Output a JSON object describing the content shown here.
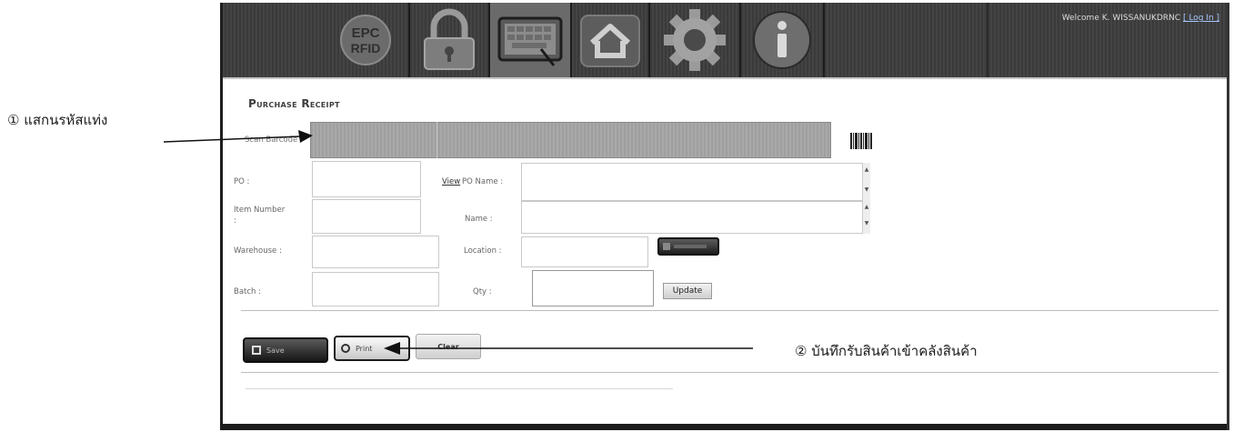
{
  "header": {
    "logo_text": "EPC RFID",
    "welcome_text": "Welcome K. WISSANUKDRNC",
    "login_label": "[ Log In ]"
  },
  "form": {
    "title": "Purchase Receipt",
    "scan_barcode_label": "Scan Barcode",
    "po_label": "PO :",
    "view_link": "View",
    "po_name_label": "PO Name :",
    "item_number_label": "Item Number :",
    "name_label": "Name :",
    "warehouse_label": "Warehouse :",
    "location_label": "Location :",
    "batch_label": "Batch :",
    "qty_label": "Qty :",
    "update_button": "Update",
    "save_button": "Save",
    "print_button": "Print",
    "clear_button": "Clear"
  },
  "annotations": {
    "step1": "① แสกนรหัสแท่ง",
    "step2": "② บันทึกรับสินค้าเข้าคลังสินค้า"
  }
}
